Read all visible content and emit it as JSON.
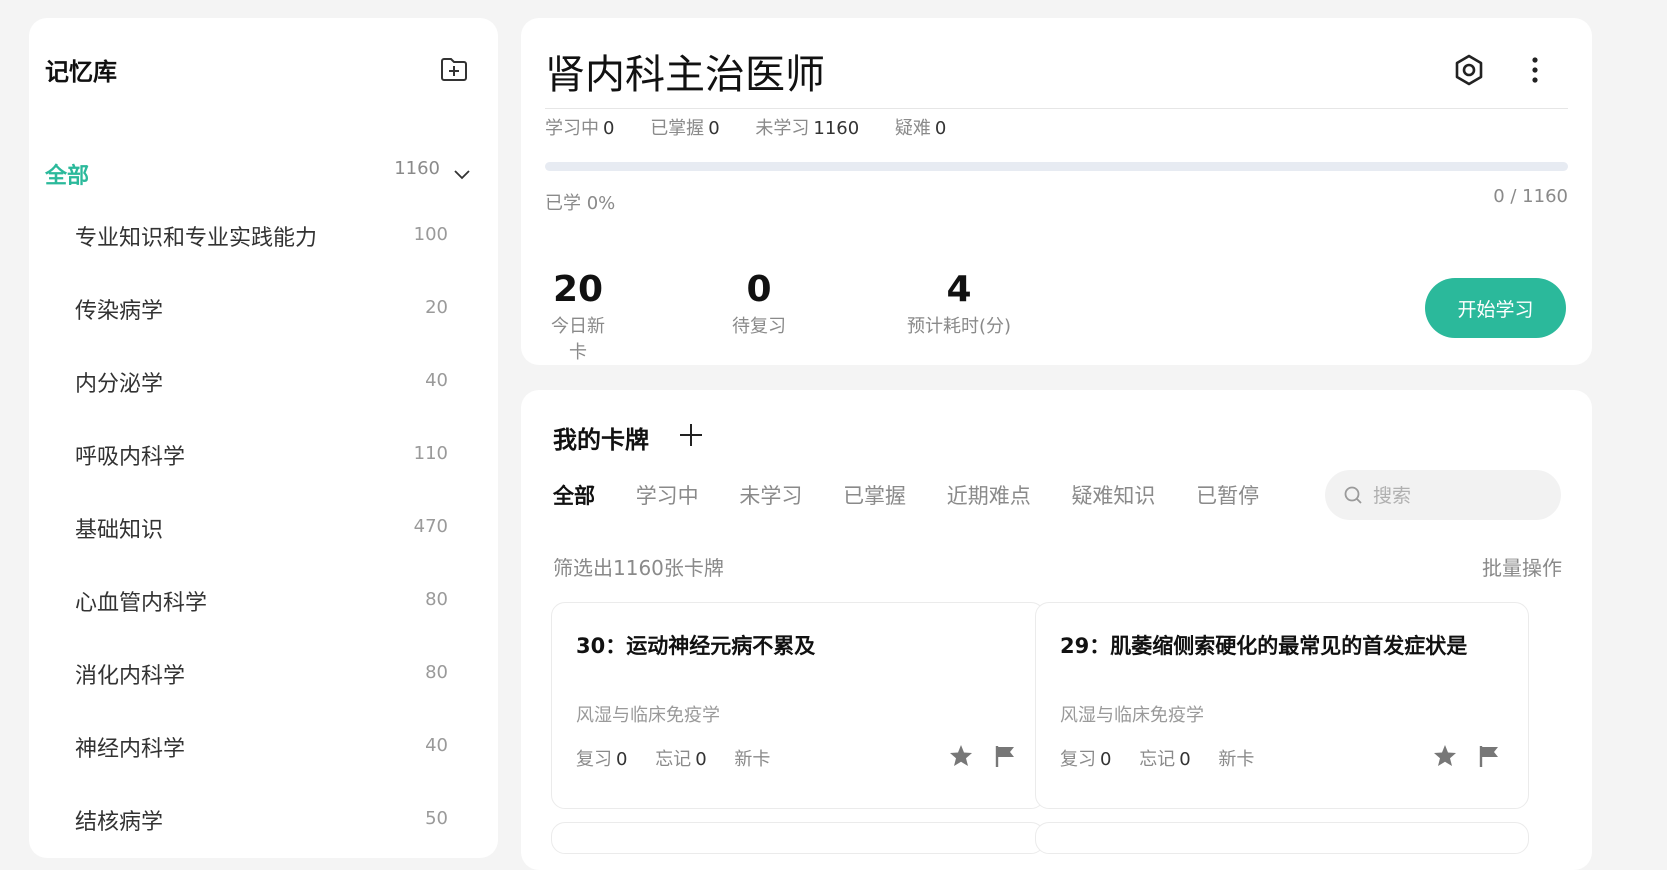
{
  "sidebar": {
    "title": "记忆库",
    "all": {
      "label": "全部",
      "count": "1160"
    },
    "items": [
      {
        "label": "专业知识和专业实践能力",
        "count": "100"
      },
      {
        "label": "传染病学",
        "count": "20"
      },
      {
        "label": "内分泌学",
        "count": "40"
      },
      {
        "label": "呼吸内科学",
        "count": "110"
      },
      {
        "label": "基础知识",
        "count": "470"
      },
      {
        "label": "心血管内科学",
        "count": "80"
      },
      {
        "label": "消化内科学",
        "count": "80"
      },
      {
        "label": "神经内科学",
        "count": "40"
      },
      {
        "label": "结核病学",
        "count": "50"
      }
    ]
  },
  "header": {
    "title": "肾内科主治医师",
    "stats": [
      {
        "label": "学习中",
        "value": "0"
      },
      {
        "label": "已掌握",
        "value": "0"
      },
      {
        "label": "未学习",
        "value": "1160"
      },
      {
        "label": "疑难",
        "value": "0"
      }
    ],
    "progress_fraction": 0,
    "learned_text": "已学 0%",
    "ratio_text": "0 / 1160",
    "metrics": [
      {
        "value": "20",
        "label": "今日新卡"
      },
      {
        "value": "0",
        "label": "待复习"
      },
      {
        "value": "4",
        "label": "预计耗时(分)"
      }
    ],
    "start_button": "开始学习"
  },
  "cards_panel": {
    "title": "我的卡牌",
    "tabs": [
      "全部",
      "学习中",
      "未学习",
      "已掌握",
      "近期难点",
      "疑难知识",
      "已暂停"
    ],
    "search_placeholder": "搜索",
    "filter_text": "筛选出1160张卡牌",
    "batch_label": "批量操作",
    "cards": [
      {
        "title": "30：运动神经元病不累及",
        "subject": "风湿与临床免疫学",
        "review_label": "复习",
        "review": "0",
        "forget_label": "忘记",
        "forget": "0",
        "status": "新卡"
      },
      {
        "title": "29：肌萎缩侧索硬化的最常见的首发症状是",
        "subject": "风湿与临床免疫学",
        "review_label": "复习",
        "review": "0",
        "forget_label": "忘记",
        "forget": "0",
        "status": "新卡"
      }
    ]
  },
  "colors": {
    "accent": "#2bb99b",
    "background": "#f4f4f4"
  }
}
